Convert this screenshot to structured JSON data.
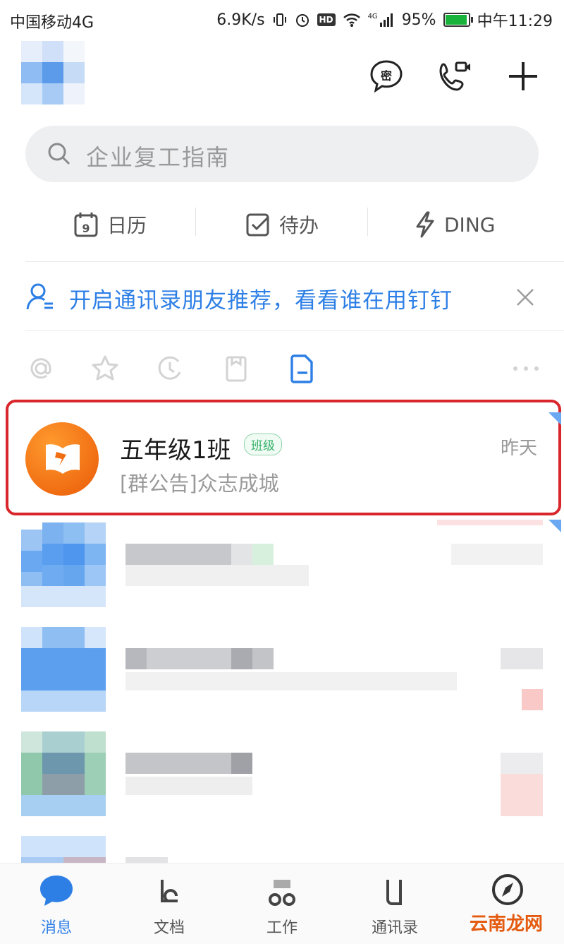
{
  "status_bar": {
    "carrier": "中国移动4G",
    "speed": "6.9K/s",
    "hd": "HD",
    "network": "4G",
    "battery": "95%",
    "battery_level": 0.95,
    "time": "中午11:29"
  },
  "header": {
    "icons": [
      "secret-chat-icon",
      "video-call-icon",
      "plus-icon"
    ],
    "secret_glyph": "密"
  },
  "search": {
    "placeholder": "企业复工指南"
  },
  "quick_actions": [
    {
      "label": "日历",
      "icon": "calendar-icon",
      "day": "9"
    },
    {
      "label": "待办",
      "icon": "todo-check-icon"
    },
    {
      "label": "DING",
      "icon": "lightning-icon"
    }
  ],
  "banner": {
    "text": "开启通讯录朋友推荐，看看谁在用钉钉"
  },
  "filters": [
    "at-icon",
    "star-icon",
    "recent-icon",
    "bookmark-icon",
    "document-icon",
    "more-icon"
  ],
  "conversations": [
    {
      "name": "五年级1班",
      "badge": "班级",
      "preview": "[群公告]众志成城",
      "time": "昨天",
      "highlighted": true
    }
  ],
  "tabs": [
    {
      "label": "消息",
      "icon": "message-icon",
      "active": true
    },
    {
      "label": "文档",
      "icon": "document-tab-icon",
      "active": false
    },
    {
      "label": "工作",
      "icon": "work-icon",
      "active": false
    },
    {
      "label": "通讯录",
      "icon": "contacts-icon",
      "active": false
    },
    {
      "label": "",
      "icon": "compass-icon",
      "active": false
    }
  ],
  "watermark": "云南龙网",
  "colors": {
    "accent": "#2d7fe6",
    "highlight_border": "#d8262c",
    "badge_green": "#35b16a",
    "avatar_orange": "#f06d12"
  }
}
